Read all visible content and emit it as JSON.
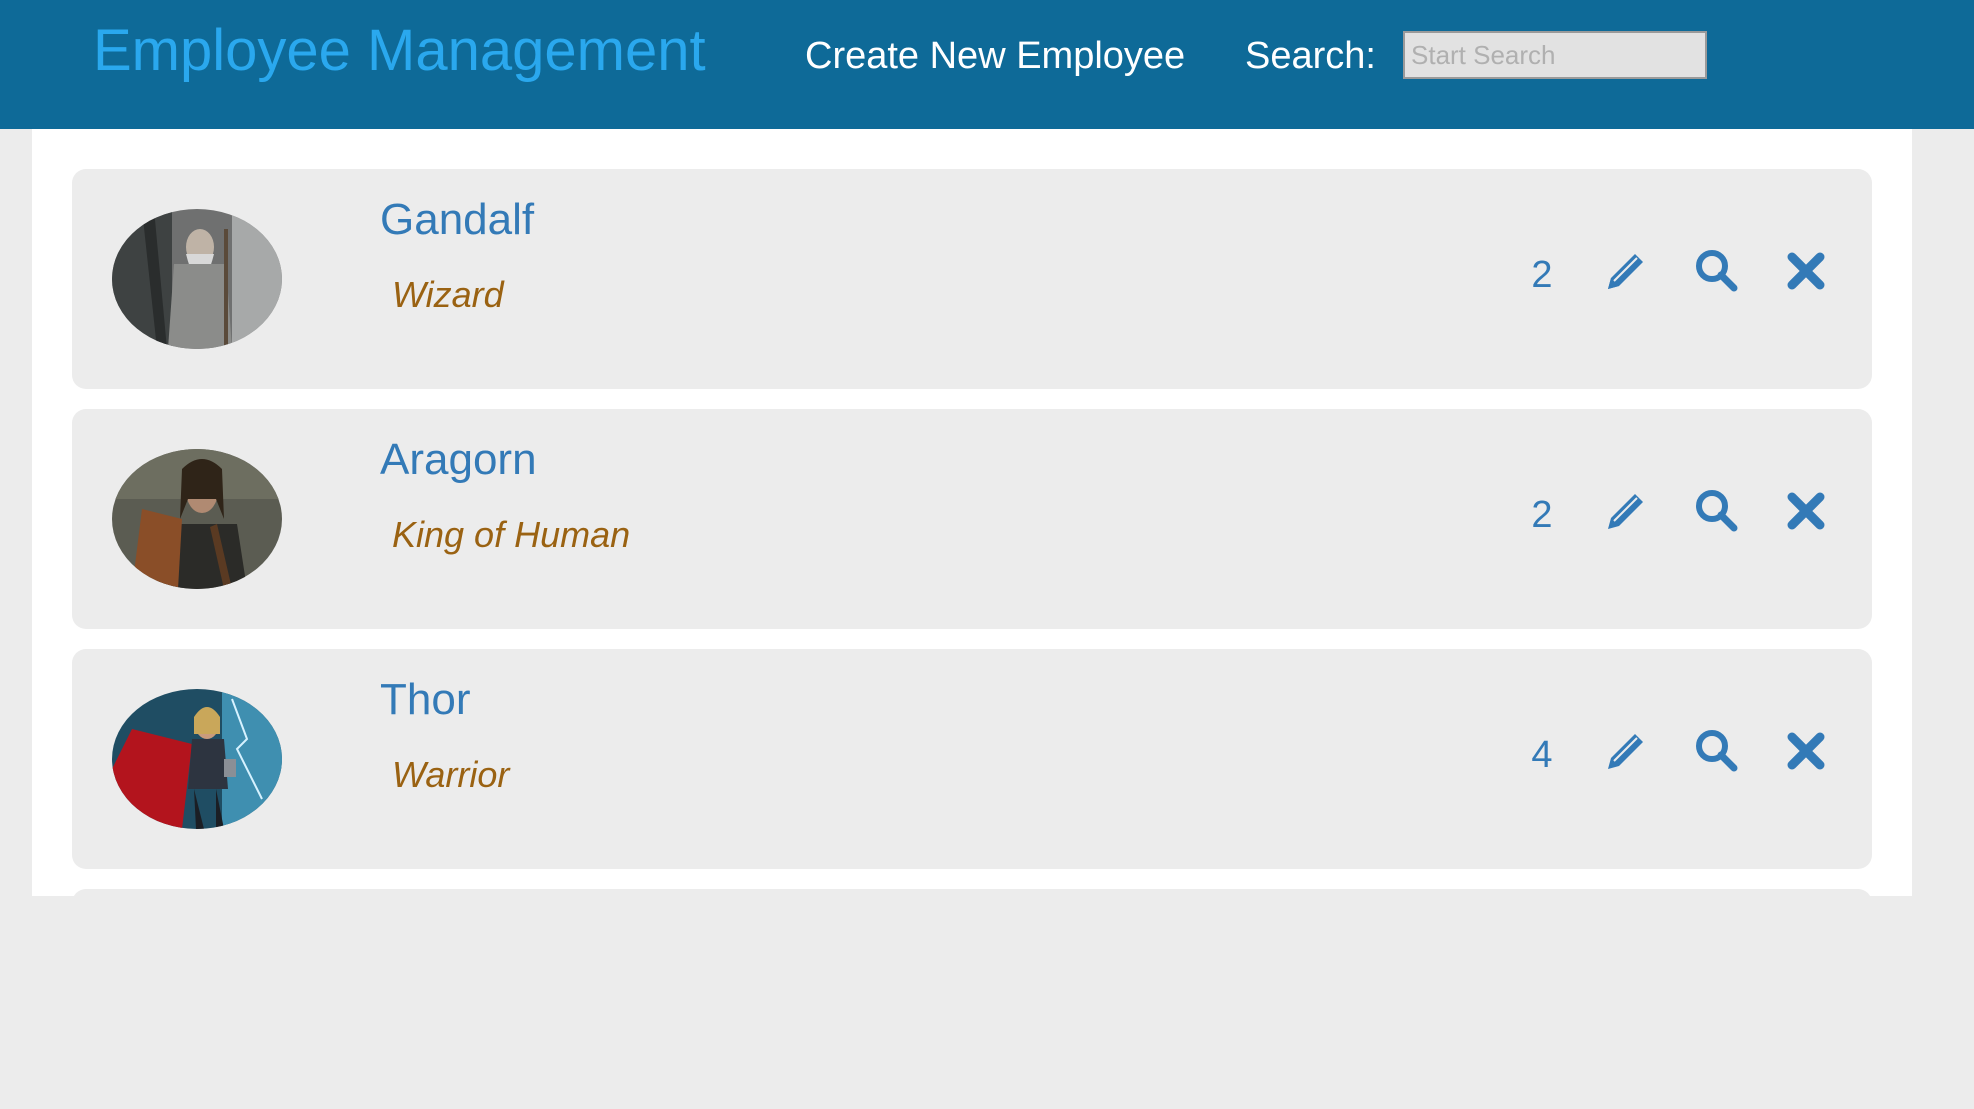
{
  "header": {
    "brand": "Employee Management",
    "create_link": "Create New Employee",
    "search_label": "Search:",
    "search_placeholder": "Start Search",
    "search_value": ""
  },
  "theme": {
    "navbar_bg": "#0e6a98",
    "brand_color": "#2aa8ee",
    "link_color": "#337ab7",
    "title_color": "#9a6212"
  },
  "employees": [
    {
      "name": "Gandalf",
      "title": "Wizard",
      "count": "2",
      "avatar_icon": "gandalf-photo"
    },
    {
      "name": "Aragorn",
      "title": "King of Human",
      "count": "2",
      "avatar_icon": "aragorn-photo"
    },
    {
      "name": "Thor",
      "title": "Warrior",
      "count": "4",
      "avatar_icon": "thor-photo"
    }
  ],
  "actions": {
    "edit_icon": "pencil-icon",
    "view_icon": "search-icon",
    "delete_icon": "close-icon"
  }
}
